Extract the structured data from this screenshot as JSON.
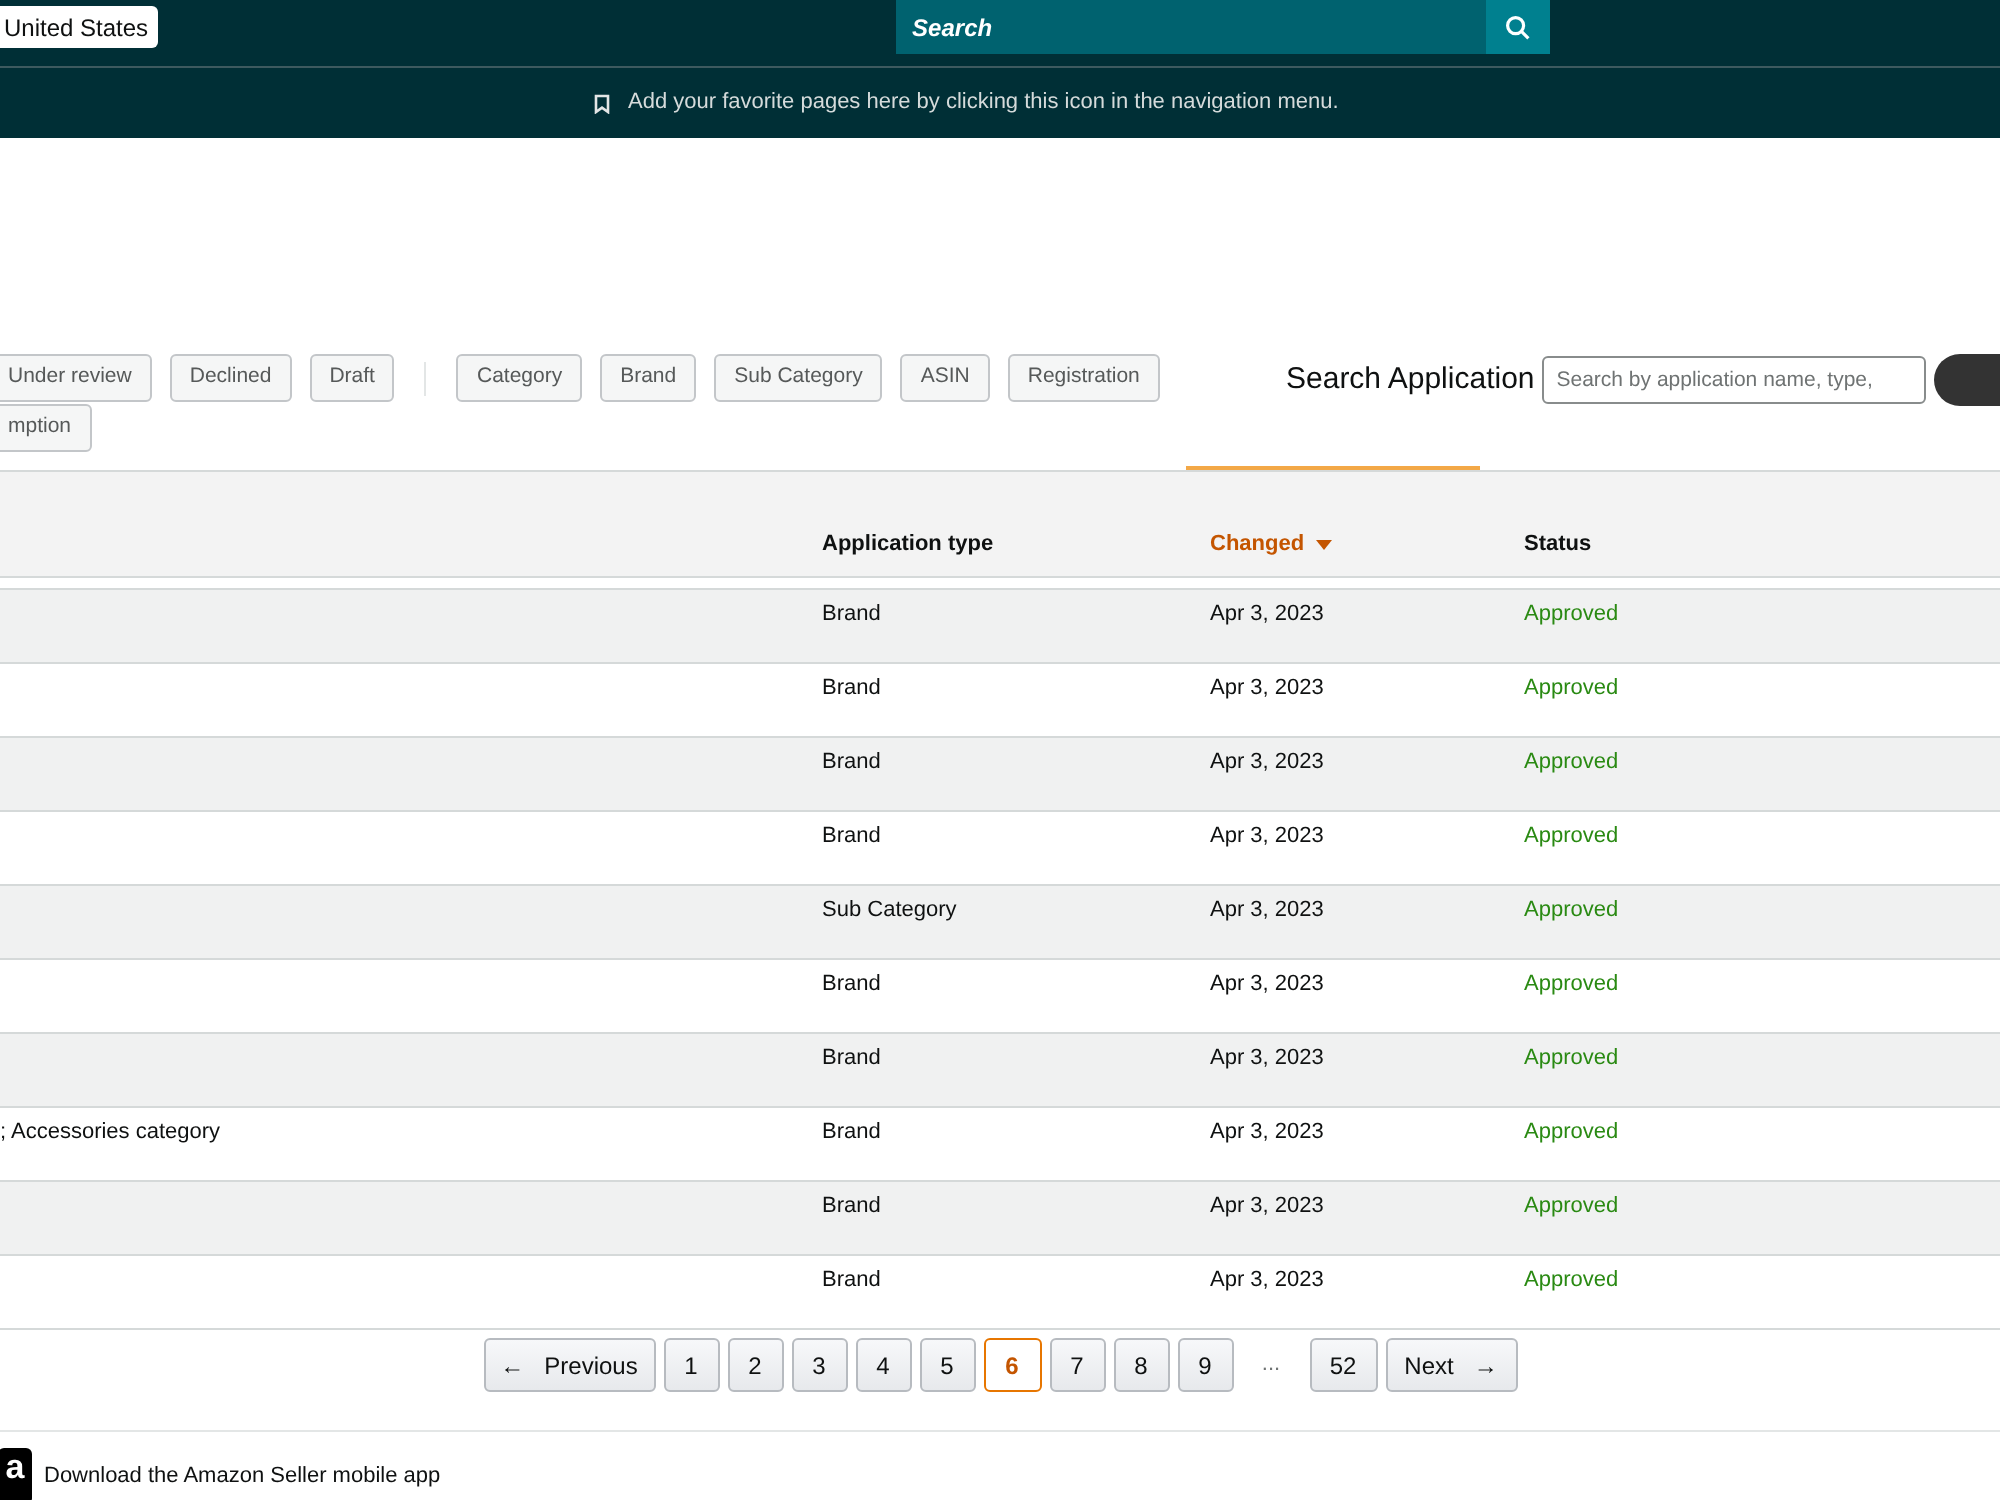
{
  "top_bar": {
    "country_button": "United States",
    "search": {
      "placeholder": "Search"
    }
  },
  "bookmark_bar": {
    "message": "Add your favorite pages here by clicking this icon in the navigation menu."
  },
  "filters": {
    "status": [
      {
        "label": "Under review",
        "selected": false
      },
      {
        "label": "Declined",
        "selected": false
      },
      {
        "label": "Draft",
        "selected": false
      }
    ],
    "type": [
      {
        "label": "Category",
        "selected": false
      },
      {
        "label": "Brand",
        "selected": false
      },
      {
        "label": "Sub Category",
        "selected": false
      },
      {
        "label": "ASIN",
        "selected": false
      },
      {
        "label": "Registration",
        "selected": false
      },
      {
        "label": "mption",
        "selected": false
      }
    ]
  },
  "search_application": {
    "label": "Search Application",
    "placeholder": "Search by application name, type,"
  },
  "table": {
    "columns": [
      {
        "label": "Application type",
        "sorted": false
      },
      {
        "label": "Changed",
        "sorted": true
      },
      {
        "label": "Status",
        "sorted": false
      }
    ],
    "rows": [
      {
        "application_type": "Brand",
        "changed": "Apr 3, 2023",
        "status": "Approved"
      },
      {
        "application_type": "Brand",
        "changed": "Apr 3, 2023",
        "status": "Approved"
      },
      {
        "application_type": "Brand",
        "changed": "Apr 3, 2023",
        "status": "Approved"
      },
      {
        "application_type": "Brand",
        "changed": "Apr 3, 2023",
        "status": "Approved"
      },
      {
        "application_type": "Sub Category",
        "changed": "Apr 3, 2023",
        "status": "Approved"
      },
      {
        "application_type": "Brand",
        "changed": "Apr 3, 2023",
        "status": "Approved"
      },
      {
        "application_type": "Brand",
        "changed": "Apr 3, 2023",
        "status": "Approved"
      },
      {
        "column_1": "; Accessories category",
        "application_type": "Brand",
        "changed": "Apr 3, 2023",
        "status": "Approved"
      },
      {
        "application_type": "Brand",
        "changed": "Apr 3, 2023",
        "status": "Approved"
      },
      {
        "application_type": "Brand",
        "changed": "Apr 3, 2023",
        "status": "Approved"
      }
    ]
  },
  "pagination": {
    "previous": {
      "arrow": "←",
      "label": "Previous"
    },
    "pages": [
      {
        "label": "1",
        "selected": false
      },
      {
        "label": "2",
        "selected": false
      },
      {
        "label": "3",
        "selected": false
      },
      {
        "label": "4",
        "selected": false
      },
      {
        "label": "5",
        "selected": false
      },
      {
        "label": "6",
        "selected": true
      },
      {
        "label": "7",
        "selected": false
      },
      {
        "label": "8",
        "selected": false
      },
      {
        "label": "9",
        "selected": false
      }
    ],
    "ellipsis": "...",
    "last_page": {
      "label": "52",
      "selected": false
    },
    "next": {
      "label": "Next",
      "arrow": "→"
    }
  },
  "footer": {
    "app_logo_letter": "a",
    "text": "Download the Amazon Seller mobile app"
  }
}
